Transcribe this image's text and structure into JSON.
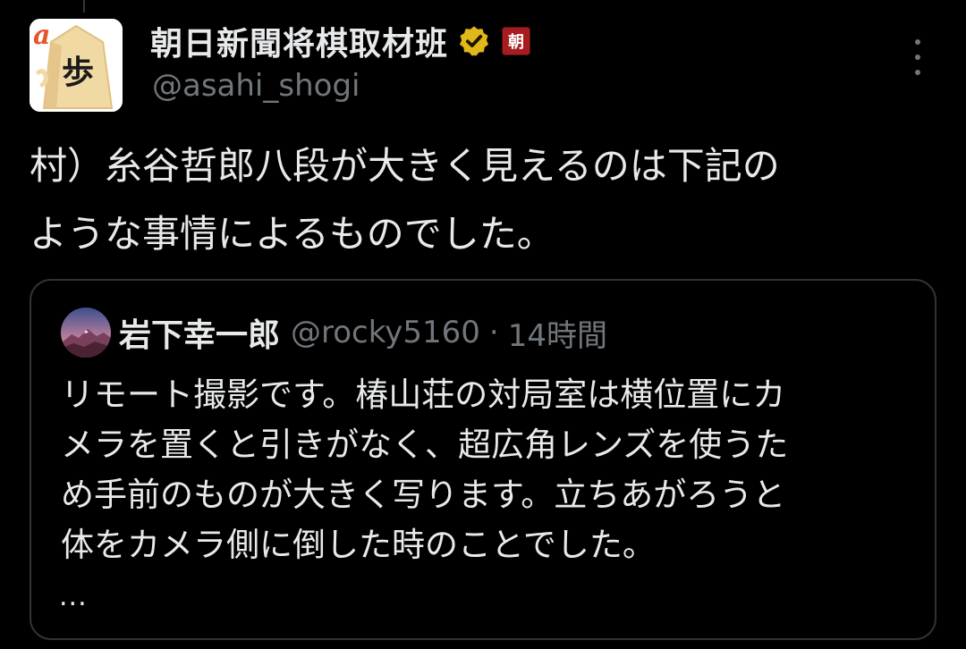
{
  "tweet": {
    "author": {
      "display_name": "朝日新聞将棋取材班",
      "handle": "@asahi_shogi",
      "avatar_icon": "shogi-piece-logo",
      "avatar_logo_text": "a",
      "avatar_piece_char": "歩",
      "verified_icon": "gold-verified-badge-icon",
      "affiliation_badge": "朝"
    },
    "more_icon": "vertical-ellipsis-icon",
    "text": "村）糸谷哲郎八段が大きく見えるのは下記の\nような事情によるものでした。"
  },
  "quoted_tweet": {
    "author": {
      "display_name": "岩下幸一郎",
      "handle": "@rocky5160",
      "avatar_icon": "mountain-photo-avatar"
    },
    "separator": "·",
    "timestamp": "14時間",
    "text": "リモート撮影です。椿山荘の対局室は横位置にカ\nメラを置くと引きがなく、超広角レンズを使うた\nめ手前のものが大きく写ります。立ちあがろうと\n体をカメラ側に倒した時のことでした。",
    "truncation": "..."
  },
  "colors": {
    "background": "#000000",
    "primary_text": "#e7e9ea",
    "secondary_text": "#71767b",
    "border": "#2f3336",
    "verified_gold": "#e2b719",
    "affiliation_red": "#a51d21"
  }
}
